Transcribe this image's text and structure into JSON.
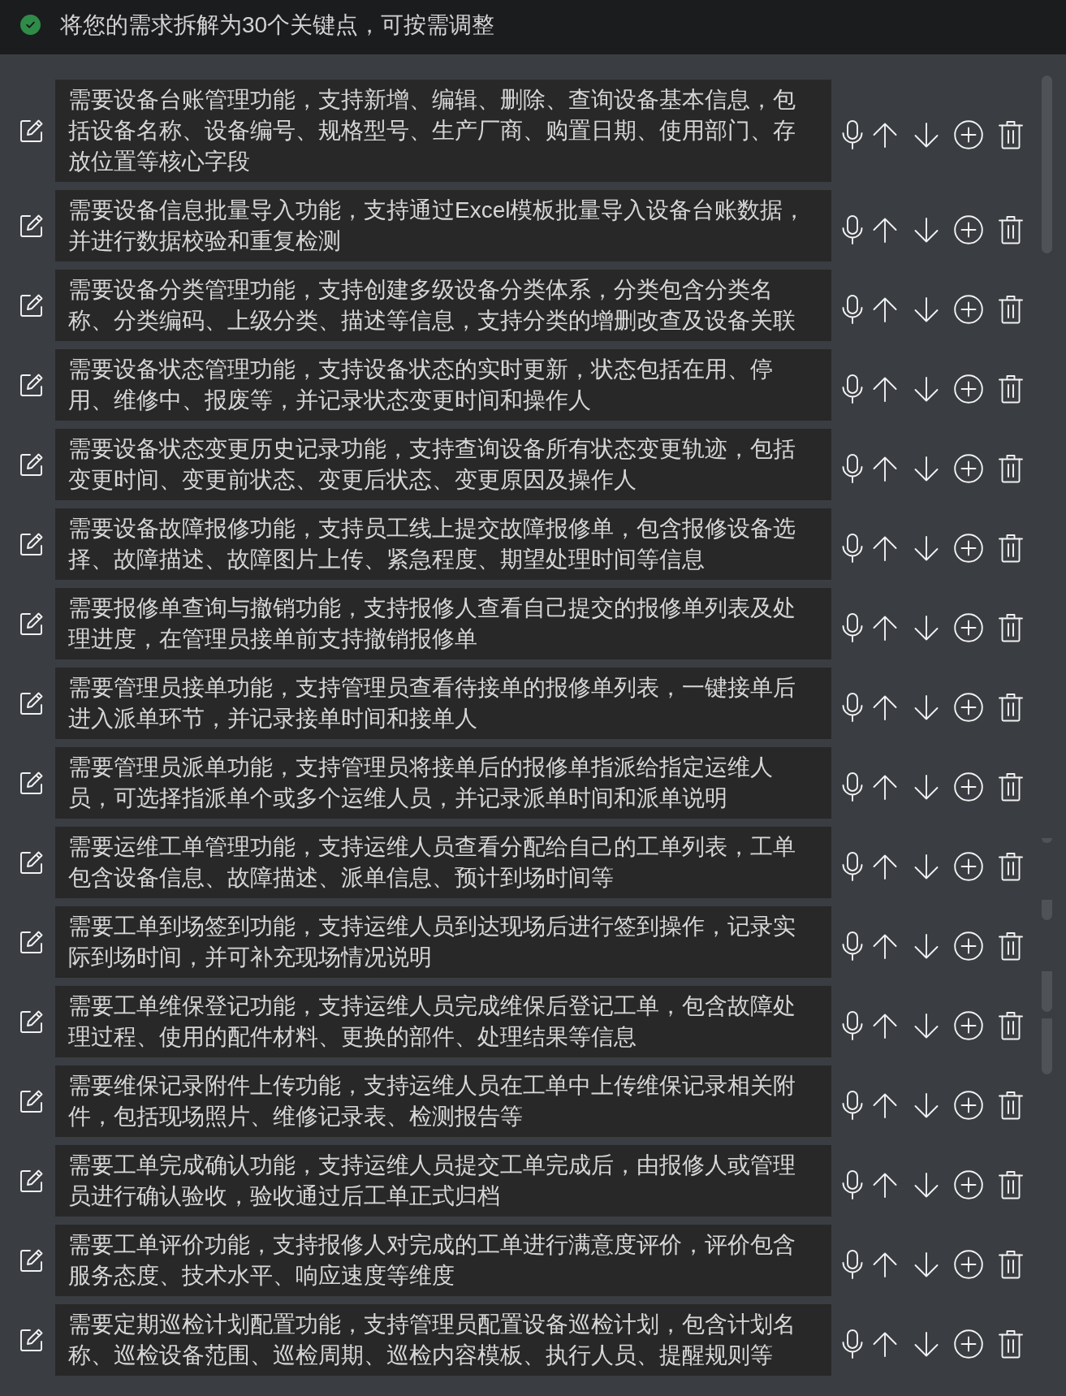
{
  "header": {
    "title": "将您的需求拆解为30个关键点，可按需调整"
  },
  "items": [
    {
      "text": "需要设备台账管理功能，支持新增、编辑、删除、查询设备基本信息，包括设备名称、设备编号、规格型号、生产厂商、购置日期、使用部门、存放位置等核心字段"
    },
    {
      "text": "需要设备信息批量导入功能，支持通过Excel模板批量导入设备台账数据，并进行数据校验和重复检测"
    },
    {
      "text": "需要设备分类管理功能，支持创建多级设备分类体系，分类包含分类名称、分类编码、上级分类、描述等信息，支持分类的增删改查及设备关联"
    },
    {
      "text": "需要设备状态管理功能，支持设备状态的实时更新，状态包括在用、停用、维修中、报废等，并记录状态变更时间和操作人"
    },
    {
      "text": "需要设备状态变更历史记录功能，支持查询设备所有状态变更轨迹，包括变更时间、变更前状态、变更后状态、变更原因及操作人"
    },
    {
      "text": "需要设备故障报修功能，支持员工线上提交故障报修单，包含报修设备选择、故障描述、故障图片上传、紧急程度、期望处理时间等信息"
    },
    {
      "text": "需要报修单查询与撤销功能，支持报修人查看自己提交的报修单列表及处理进度，在管理员接单前支持撤销报修单"
    },
    {
      "text": "需要管理员接单功能，支持管理员查看待接单的报修单列表，一键接单后进入派单环节，并记录接单时间和接单人"
    },
    {
      "text": "需要管理员派单功能，支持管理员将接单后的报修单指派给指定运维人员，可选择指派单个或多个运维人员，并记录派单时间和派单说明"
    },
    {
      "text": "需要运维工单管理功能，支持运维人员查看分配给自己的工单列表，工单包含设备信息、故障描述、派单信息、预计到场时间等"
    },
    {
      "text": "需要工单到场签到功能，支持运维人员到达现场后进行签到操作，记录实际到场时间，并可补充现场情况说明"
    },
    {
      "text": "需要工单维保登记功能，支持运维人员完成维保后登记工单，包含故障处理过程、使用的配件材料、更换的部件、处理结果等信息"
    },
    {
      "text": "需要维保记录附件上传功能，支持运维人员在工单中上传维保记录相关附件，包括现场照片、维修记录表、检测报告等"
    },
    {
      "text": "需要工单完成确认功能，支持运维人员提交工单完成后，由报修人或管理员进行确认验收，验收通过后工单正式归档"
    },
    {
      "text": "需要工单评价功能，支持报修人对完成的工单进行满意度评价，评价包含服务态度、技术水平、响应速度等维度"
    },
    {
      "text": "需要定期巡检计划配置功能，支持管理员配置设备巡检计划，包含计划名称、巡检设备范围、巡检周期、巡检内容模板、执行人员、提醒规则等"
    }
  ]
}
